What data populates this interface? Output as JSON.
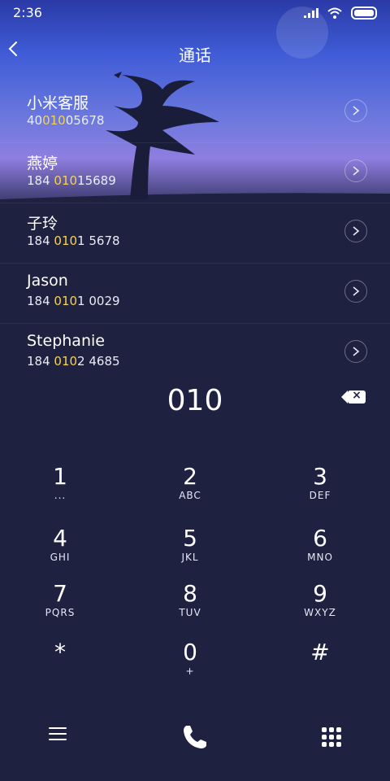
{
  "status": {
    "time": "2:36"
  },
  "header": {
    "title": "通话"
  },
  "contacts": [
    {
      "name": "小米客服",
      "pre": "40",
      "hl": "010",
      "post": "05678"
    },
    {
      "name": "燕婷",
      "pre": "184 ",
      "hl": "010",
      "post": "15689"
    },
    {
      "name": "子玲",
      "pre": "184 ",
      "hl": "010",
      "post": "1 5678"
    },
    {
      "name": "Jason",
      "pre": "184 ",
      "hl": "010",
      "post": "1 0029"
    },
    {
      "name": "Stephanie",
      "pre": "184 ",
      "hl": "010",
      "post": "2 4685"
    }
  ],
  "dial": {
    "value": "010"
  },
  "keys": [
    {
      "num": "1",
      "sub": "..."
    },
    {
      "num": "2",
      "sub": "ABC"
    },
    {
      "num": "3",
      "sub": "DEF"
    },
    {
      "num": "4",
      "sub": "GHI"
    },
    {
      "num": "5",
      "sub": "JKL"
    },
    {
      "num": "6",
      "sub": "MNO"
    },
    {
      "num": "7",
      "sub": "PQRS"
    },
    {
      "num": "8",
      "sub": "TUV"
    },
    {
      "num": "9",
      "sub": "WXYZ"
    },
    {
      "num": "*",
      "sub": ""
    },
    {
      "num": "0",
      "sub": "+"
    },
    {
      "num": "#",
      "sub": ""
    }
  ],
  "icons": {
    "back": "chevron-left-icon",
    "wifi": "wifi-icon",
    "signal": "signal-icon",
    "battery": "battery-icon",
    "menu": "menu-icon",
    "call": "phone-icon",
    "keypad": "keypad-icon",
    "delete": "backspace-icon"
  },
  "colors": {
    "highlight": "#f7d34a",
    "background": "#1e2140",
    "sky_top": "#2a3aa6"
  }
}
